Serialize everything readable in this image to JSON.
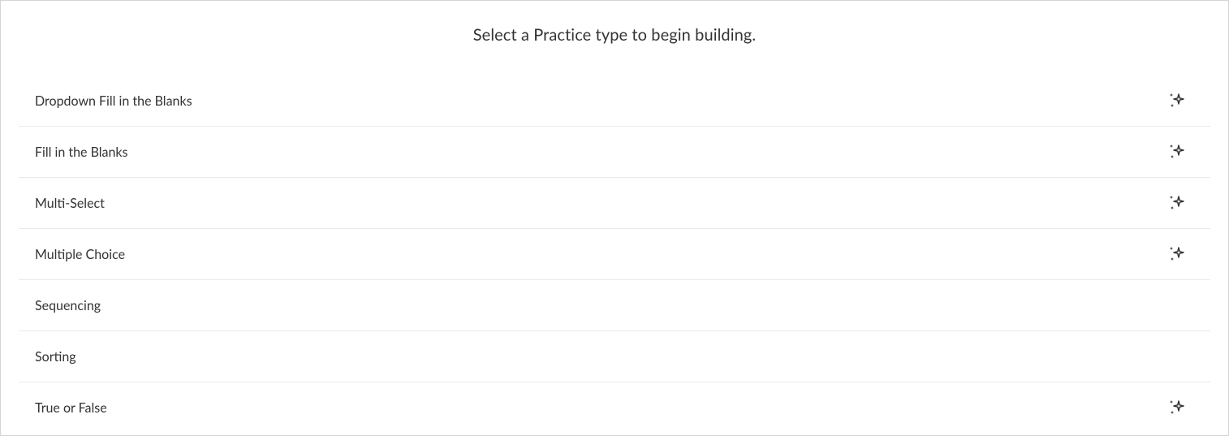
{
  "title": "Select a Practice type to begin building.",
  "practice_types": [
    {
      "label": "Dropdown Fill in the Blanks",
      "has_sparkle": true
    },
    {
      "label": "Fill in the Blanks",
      "has_sparkle": true
    },
    {
      "label": "Multi-Select",
      "has_sparkle": true
    },
    {
      "label": "Multiple Choice",
      "has_sparkle": true
    },
    {
      "label": "Sequencing",
      "has_sparkle": false
    },
    {
      "label": "Sorting",
      "has_sparkle": false
    },
    {
      "label": "True or False",
      "has_sparkle": true
    }
  ]
}
